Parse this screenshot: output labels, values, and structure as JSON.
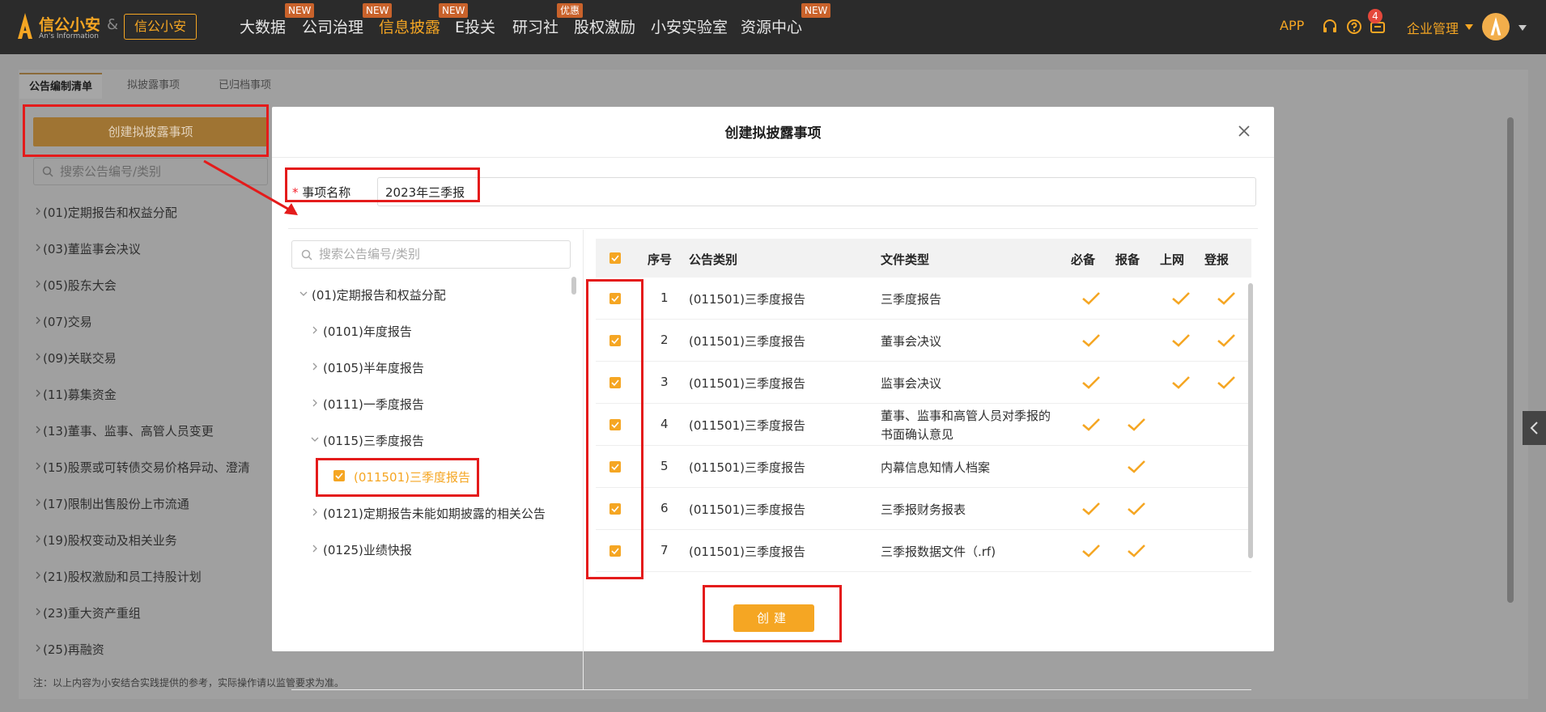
{
  "topnav": {
    "logo_name": "信公小安",
    "logo_sub": "An's Information",
    "amp": "&",
    "brand_badge": "信公小安",
    "items": [
      {
        "label": "大数据",
        "tag": "NEW"
      },
      {
        "label": "公司治理",
        "tag": "NEW"
      },
      {
        "label": "信息披露",
        "tag": "NEW"
      },
      {
        "label": "E投关",
        "tag": ""
      },
      {
        "label": "研习社",
        "tag": "优惠"
      },
      {
        "label": "股权激励",
        "tag": ""
      },
      {
        "label": "小安实验室",
        "tag": ""
      },
      {
        "label": "资源中心",
        "tag": "NEW"
      }
    ],
    "app_label": "APP",
    "message_count": "4",
    "org_menu": "企业管理",
    "colors": {
      "bar": "#2b2b2b",
      "accent": "#f5a623",
      "tag": "#c9622b"
    }
  },
  "background": {
    "tabs": [
      "公告编制清单",
      "拟披露事项",
      "已归档事项"
    ],
    "create_button": "创建拟披露事项",
    "search_placeholder": "搜索公告编号/类别",
    "categories": [
      "(01)定期报告和权益分配",
      "(03)董监事会决议",
      "(05)股东大会",
      "(07)交易",
      "(09)关联交易",
      "(11)募集资金",
      "(13)董事、监事、高管人员变更",
      "(15)股票或可转债交易价格异动、澄清",
      "(17)限制出售股份上市流通",
      "(19)股权变动及相关业务",
      "(21)股权激励和员工持股计划",
      "(23)重大资产重组",
      "(25)再融资"
    ],
    "note": "注：以上内容为小安结合实践提供的参考，实际操作请以监管要求为准。"
  },
  "modal": {
    "title": "创建拟披露事项",
    "field_required_mark": "*",
    "field_label": "事项名称",
    "field_value": "2023年三季报",
    "tree_search_placeholder": "搜索公告编号/类别",
    "tree": {
      "root": "(01)定期报告和权益分配",
      "children": [
        "(0101)年度报告",
        "(0105)半年度报告",
        "(0111)一季度报告",
        "(0115)三季度报告"
      ],
      "selected_leaf": "(011501)三季度报告",
      "after": [
        "(0121)定期报告未能如期披露的相关公告",
        "(0125)业绩快报"
      ]
    },
    "table": {
      "columns": [
        "序号",
        "公告类别",
        "文件类型",
        "必备",
        "报备",
        "上网",
        "登报"
      ],
      "rows": [
        {
          "no": "1",
          "category": "(011501)三季度报告",
          "type": "三季度报告",
          "type2": "",
          "required": true,
          "filing": false,
          "online": true,
          "newspaper": true
        },
        {
          "no": "2",
          "category": "(011501)三季度报告",
          "type": "董事会决议",
          "type2": "",
          "required": true,
          "filing": false,
          "online": true,
          "newspaper": true
        },
        {
          "no": "3",
          "category": "(011501)三季度报告",
          "type": "监事会决议",
          "type2": "",
          "required": true,
          "filing": false,
          "online": true,
          "newspaper": true
        },
        {
          "no": "4",
          "category": "(011501)三季度报告",
          "type": "董事、监事和高管人员对季报的",
          "type2": "书面确认意见",
          "required": true,
          "filing": true,
          "online": false,
          "newspaper": false
        },
        {
          "no": "5",
          "category": "(011501)三季度报告",
          "type": "内幕信息知情人档案",
          "type2": "",
          "required": false,
          "filing": true,
          "online": false,
          "newspaper": false
        },
        {
          "no": "6",
          "category": "(011501)三季度报告",
          "type": "三季报财务报表",
          "type2": "",
          "required": true,
          "filing": true,
          "online": false,
          "newspaper": false
        },
        {
          "no": "7",
          "category": "(011501)三季度报告",
          "type": "三季报数据文件（.rf)",
          "type2": "",
          "required": true,
          "filing": true,
          "online": false,
          "newspaper": false
        }
      ]
    },
    "create_button": "创建"
  }
}
